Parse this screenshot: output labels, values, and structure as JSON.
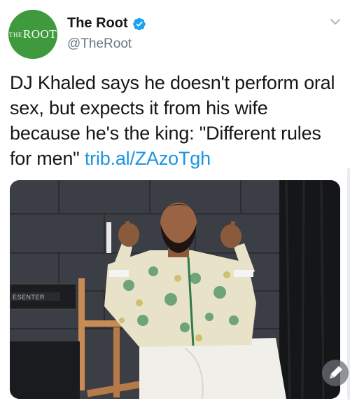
{
  "account": {
    "display_name": "The Root",
    "handle": "@TheRoot",
    "avatar_logo_small": "THE",
    "avatar_logo_big": "ROOT",
    "verified": true
  },
  "tweet": {
    "text": "DJ Khaled says he doesn't perform oral sex, but expects it from his wife because he's the king: \"Different rules for men\" ",
    "link": "trib.al/ZAzoTgh"
  },
  "media": {
    "chair_label": "ESENTER"
  },
  "colors": {
    "brand_green": "#3f9a3d",
    "link_blue": "#1b95e0",
    "verified_blue": "#1da1f2",
    "handle_gray": "#657786"
  },
  "icons": [
    "verified-badge-icon",
    "chevron-down-icon",
    "edit-pencil-icon"
  ]
}
